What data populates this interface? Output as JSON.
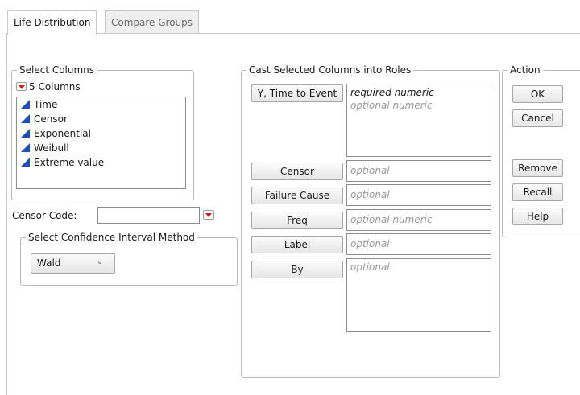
{
  "tabs": [
    {
      "label": "Life Distribution",
      "active": true
    },
    {
      "label": "Compare Groups",
      "active": false
    }
  ],
  "select_columns": {
    "legend": "Select Columns",
    "count_label": "5 Columns",
    "columns": [
      "Time",
      "Censor",
      "Exponential",
      "Weibull",
      "Extreme value"
    ]
  },
  "censor_code": {
    "label": "Censor Code:",
    "value": ""
  },
  "ci_method": {
    "legend": "Select Confidence Interval Method",
    "selected": "Wald",
    "chevron": "⌄"
  },
  "cast_roles": {
    "legend": "Cast Selected Columns into Roles",
    "roles": [
      {
        "button": "Y, Time to Event",
        "hints": [
          "required numeric",
          "optional numeric"
        ]
      },
      {
        "button": "Censor",
        "hints": [
          "optional"
        ]
      },
      {
        "button": "Failure Cause",
        "hints": [
          "optional"
        ]
      },
      {
        "button": "Freq",
        "hints": [
          "optional numeric"
        ]
      },
      {
        "button": "Label",
        "hints": [
          "optional"
        ]
      },
      {
        "button": "By",
        "hints": [
          "optional"
        ]
      }
    ]
  },
  "action": {
    "legend": "Action",
    "buttons": [
      "OK",
      "Cancel",
      "Remove",
      "Recall",
      "Help"
    ]
  },
  "colors": {
    "column_icon": "#1c4fc2",
    "red_triangle": "#d21a1a",
    "hint_text": "#9a9a9a"
  }
}
